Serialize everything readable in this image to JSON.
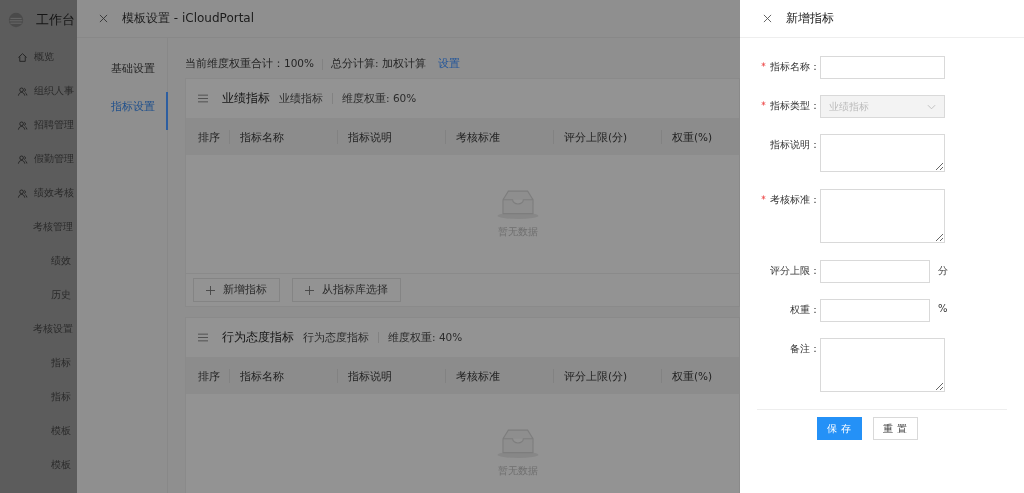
{
  "app_sidebar": {
    "title": "工作台",
    "items": [
      {
        "label": "概览"
      },
      {
        "label": "组织人事"
      },
      {
        "label": "招聘管理"
      },
      {
        "label": "假勤管理"
      },
      {
        "label": "绩效考核",
        "children": [
          {
            "label": "考核管理",
            "children": [
              {
                "label": "绩效"
              },
              {
                "label": "历史"
              }
            ]
          },
          {
            "label": "考核设置",
            "children": [
              {
                "label": "指标"
              },
              {
                "label": "指标"
              },
              {
                "label": "模板"
              },
              {
                "label": "模板"
              }
            ]
          }
        ]
      }
    ]
  },
  "modal": {
    "title": "模板设置 - iCloudPortal",
    "nav": [
      {
        "label": "基础设置",
        "selected": false
      },
      {
        "label": "指标设置",
        "selected": true
      }
    ],
    "summary": {
      "total": "当前维度权重合计：100%",
      "method": "总分计算: 加权计算",
      "link": "设置"
    },
    "sections": [
      {
        "title": "业绩指标",
        "tag": "业绩指标",
        "weight": "维度权重: 60%",
        "columns": [
          "排序",
          "指标名称",
          "指标说明",
          "考核标准",
          "评分上限(分)",
          "权重(%)"
        ],
        "empty": "暂无数据",
        "buttons": [
          "新增指标",
          "从指标库选择"
        ]
      },
      {
        "title": "行为态度指标",
        "tag": "行为态度指标",
        "weight": "维度权重: 40%",
        "columns": [
          "排序",
          "指标名称",
          "指标说明",
          "考核标准",
          "评分上限(分)",
          "权重(%)"
        ],
        "empty": "暂无数据"
      }
    ]
  },
  "drawer": {
    "title": "新增指标",
    "fields": [
      {
        "label": "指标名称：",
        "required": true,
        "kind": "input"
      },
      {
        "label": "指标类型：",
        "required": true,
        "kind": "select",
        "value": "业绩指标",
        "disabled": true
      },
      {
        "label": "指标说明：",
        "required": false,
        "kind": "textarea"
      },
      {
        "label": "考核标准：",
        "required": true,
        "kind": "textarea"
      },
      {
        "label": "评分上限：",
        "required": false,
        "kind": "input",
        "suffix": "分"
      },
      {
        "label": "权重：",
        "required": false,
        "kind": "input",
        "suffix": "%"
      },
      {
        "label": "备注：",
        "required": false,
        "kind": "textarea"
      }
    ],
    "buttons": [
      {
        "label": "保 存",
        "kind": "primary"
      },
      {
        "label": "重 置",
        "kind": "default"
      }
    ]
  }
}
